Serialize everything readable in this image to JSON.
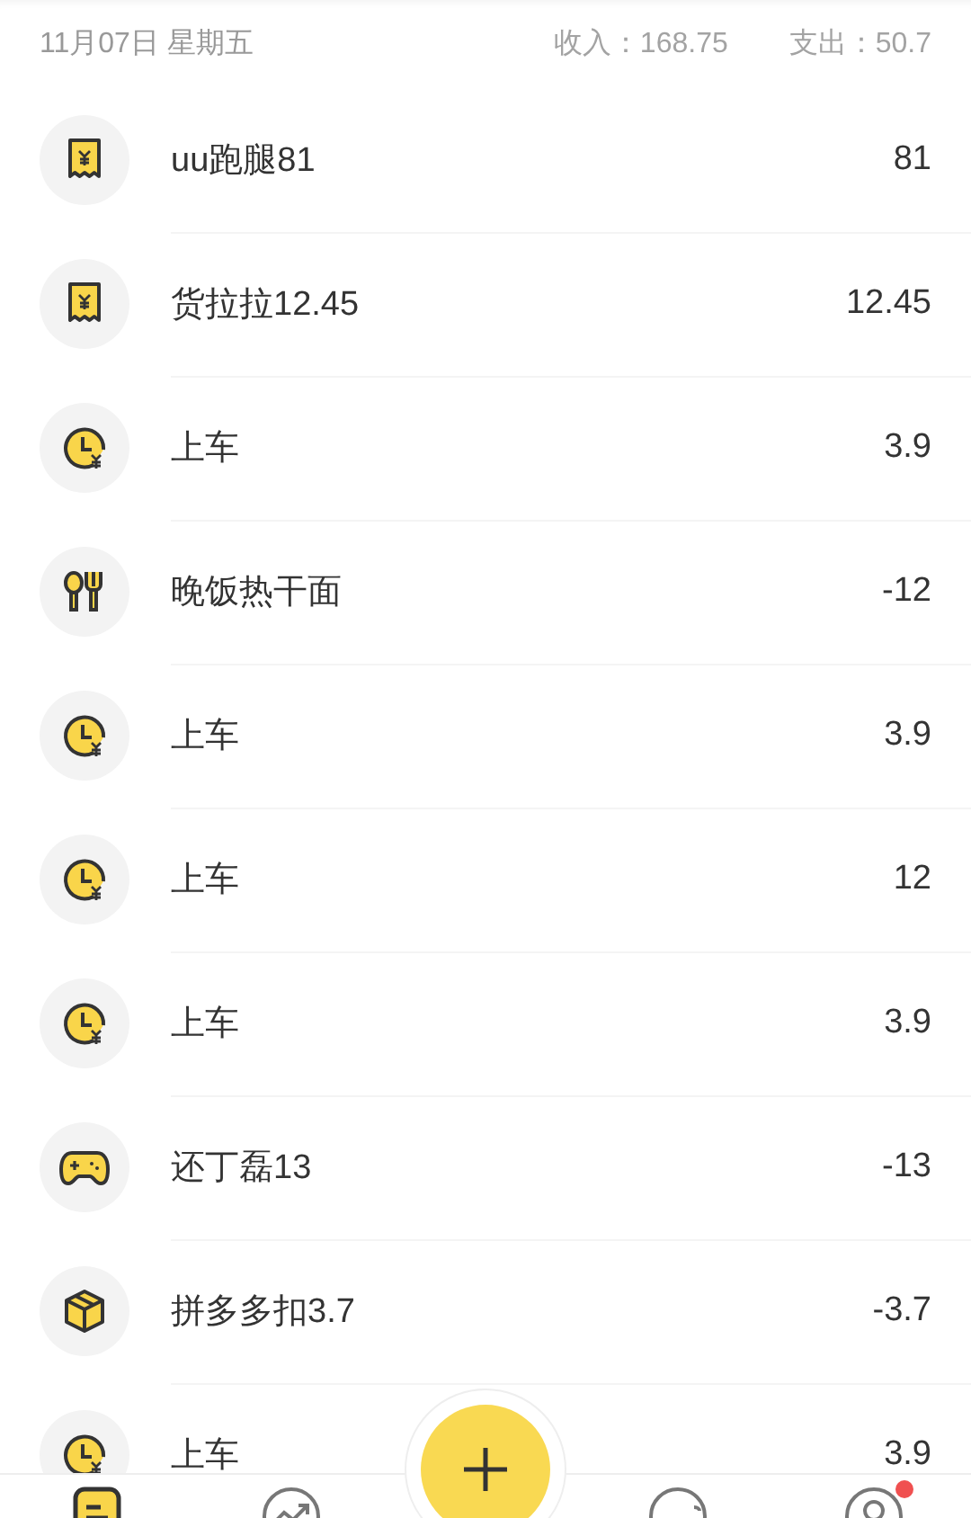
{
  "day_header": {
    "date": "11月07日 星期五",
    "income": "收入：168.75",
    "expense": "支出：50.7"
  },
  "records": [
    {
      "kind": "receipt",
      "title": "uu跑腿81",
      "amount": "81"
    },
    {
      "kind": "receipt",
      "title": "货拉拉12.45",
      "amount": "12.45"
    },
    {
      "kind": "clock",
      "title": "上车",
      "amount": "3.9"
    },
    {
      "kind": "utensils",
      "title": "晚饭热干面",
      "amount": "-12"
    },
    {
      "kind": "clock",
      "title": "上车",
      "amount": "3.9"
    },
    {
      "kind": "clock",
      "title": "上车",
      "amount": "12"
    },
    {
      "kind": "clock",
      "title": "上车",
      "amount": "3.9"
    },
    {
      "kind": "gamepad",
      "title": "还丁磊13",
      "amount": "-13"
    },
    {
      "kind": "box",
      "title": "拼多多扣3.7",
      "amount": "-3.7"
    },
    {
      "kind": "clock",
      "title": "上车",
      "amount": "3.9"
    }
  ],
  "tab_bar": [
    {
      "kind": "list",
      "selected": true,
      "dot": false
    },
    {
      "kind": "chart",
      "selected": false,
      "dot": false
    },
    {
      "kind": "add",
      "selected": false,
      "dot": false
    },
    {
      "kind": "discover",
      "selected": false,
      "dot": false
    },
    {
      "kind": "profile",
      "selected": false,
      "dot": true
    }
  ]
}
